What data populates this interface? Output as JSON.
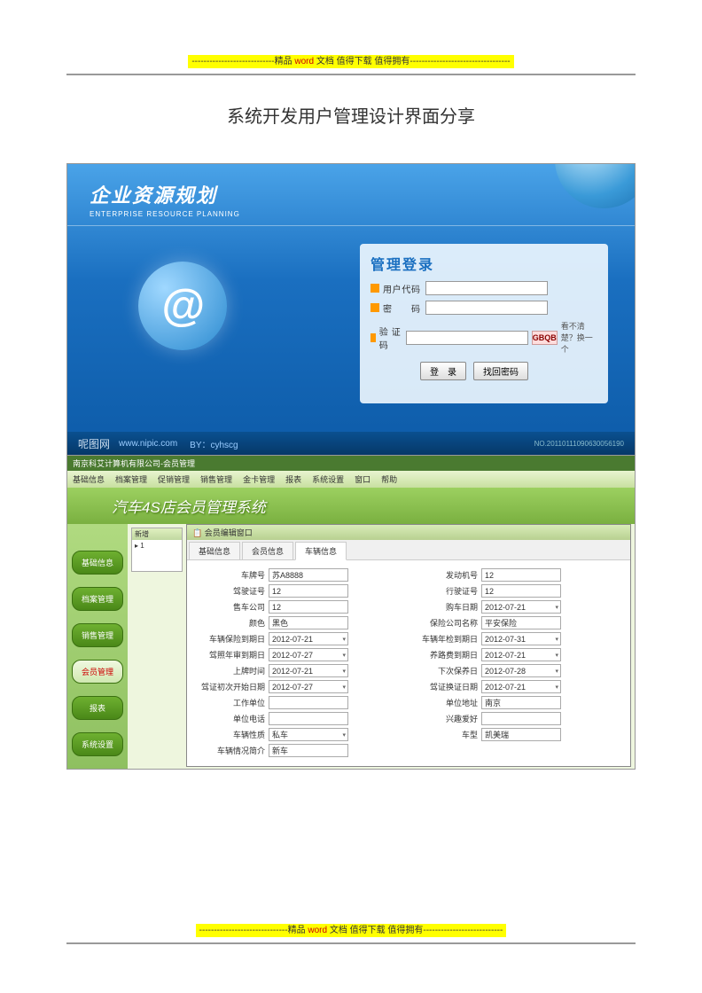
{
  "banner_top": {
    "dash": "----------------------------",
    "prefix": "精品 ",
    "word": "word",
    "suffix": " 文档  值得下载  值得拥有",
    "dash2": "----------------------------------"
  },
  "doc_title": "系统开发用户管理设计界面分享",
  "erp": {
    "title_cn": "企业资源规划",
    "title_en": "ENTERPRISE RESOURCE PLANNING",
    "login_title": "管理登录",
    "user_label": "用户代码",
    "pwd_label": "密　码",
    "captcha_label": "验 证 码",
    "captcha_value": "GBQB",
    "captcha_hint": "看不清楚？换一个",
    "btn_login": "登　录",
    "btn_find": "找回密码",
    "footer_brand": "呢图网",
    "footer_url": "www.nipic.com",
    "footer_by": "BY：cyhscg",
    "footer_no": "NO.20110111090630056190",
    "at": "@"
  },
  "s4s": {
    "window_title": "南京科艾计算机有限公司-会员管理",
    "menu": [
      "基础信息",
      "档案管理",
      "促销管理",
      "销售管理",
      "金卡管理",
      "报表",
      "系统设置",
      "窗口",
      "帮助"
    ],
    "sys_title": "汽车4S店会员管理系统",
    "side": [
      "基础信息",
      "档案管理",
      "销售管理",
      "会员管理",
      "报表",
      "系统设置"
    ],
    "side_active_idx": 3,
    "small_head": "新增",
    "small_col": "1",
    "win_title": "会员编辑窗口",
    "tabs": [
      "基础信息",
      "会员信息",
      "车辆信息"
    ],
    "active_tab_idx": 2,
    "form": {
      "车牌号": "苏A8888",
      "发动机号": "12",
      "驾驶证号": "12",
      "行驶证号": "12",
      "售车公司": "12",
      "购车日期": "2012-07-21",
      "颜色": "黑色",
      "保险公司名称": "平安保险",
      "车辆保险到期日": "2012-07-21",
      "车辆年检到期日": "2012-07-31",
      "驾照年审到期日": "2012-07-27",
      "养路费到期日": "2012-07-21",
      "上牌时间": "2012-07-21",
      "下次保养日": "2012-07-28",
      "驾证初次开始日期": "2012-07-27",
      "驾证换证日期": "2012-07-21",
      "工作单位": "",
      "单位地址": "南京",
      "单位电话": "",
      "兴趣爱好": "",
      "车辆性质": "私车",
      "车型": "凯美瑞",
      "车辆情况简介": "新车"
    }
  },
  "banner_bottom": {
    "dash": "------------------------------",
    "prefix": "精品 ",
    "word": "word",
    "suffix": " 文档  值得下载  值得拥有",
    "dash2": "---------------------------"
  }
}
